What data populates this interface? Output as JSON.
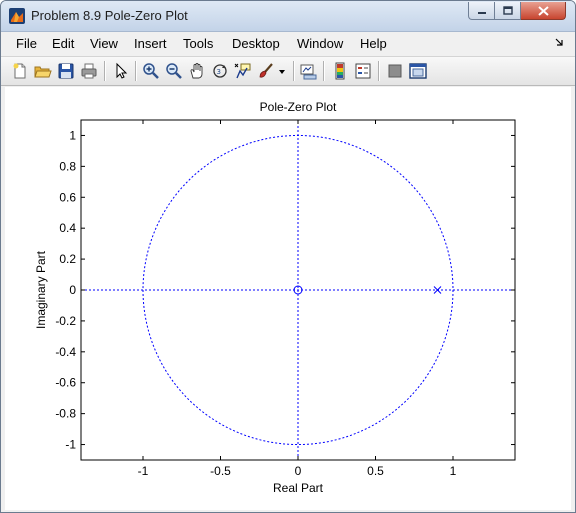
{
  "window": {
    "title": "Problem 8.9 Pole-Zero Plot",
    "icon": "matlab-figure-icon"
  },
  "menubar": {
    "items": [
      "File",
      "Edit",
      "View",
      "Insert",
      "Tools",
      "Desktop",
      "Window",
      "Help"
    ]
  },
  "toolbar": {
    "icons": [
      "new-figure-icon",
      "open-file-icon",
      "save-icon",
      "print-icon",
      "edit-plot-arrow-icon",
      "zoom-in-icon",
      "zoom-out-icon",
      "pan-hand-icon",
      "rotate-3d-icon",
      "data-cursor-icon",
      "brush-icon",
      "brush-dropdown-icon",
      "link-plot-icon",
      "insert-colorbar-icon",
      "insert-legend-icon",
      "hide-plot-tools-icon",
      "show-plot-tools-icon"
    ]
  },
  "chart_data": {
    "type": "scatter",
    "title": "Pole-Zero Plot",
    "xlabel": "Real Part",
    "ylabel": "Imaginary Part",
    "xlim": [
      -1.4,
      1.4
    ],
    "ylim": [
      -1.1,
      1.1
    ],
    "xticks": [
      -1,
      -0.5,
      0,
      0.5,
      1
    ],
    "xtick_labels": [
      "-1",
      "-0.5",
      "0",
      "0.5",
      "1"
    ],
    "yticks": [
      -1,
      -0.8,
      -0.6,
      -0.4,
      -0.2,
      0,
      0.2,
      0.4,
      0.6,
      0.8,
      1
    ],
    "ytick_labels": [
      "-1",
      "-0.8",
      "-0.6",
      "-0.4",
      "-0.2",
      "0",
      "0.2",
      "0.4",
      "0.6",
      "0.8",
      "1"
    ],
    "grid": false,
    "unit_circle": {
      "radius": 1,
      "style": "dotted",
      "color": "#0000ff"
    },
    "axis_lines": {
      "style": "dotted",
      "color": "#0000ff"
    },
    "zeros": [
      {
        "re": 0,
        "im": 0
      }
    ],
    "poles": [
      {
        "re": 0.9,
        "im": 0
      }
    ],
    "marker_color": "#0000ff"
  }
}
